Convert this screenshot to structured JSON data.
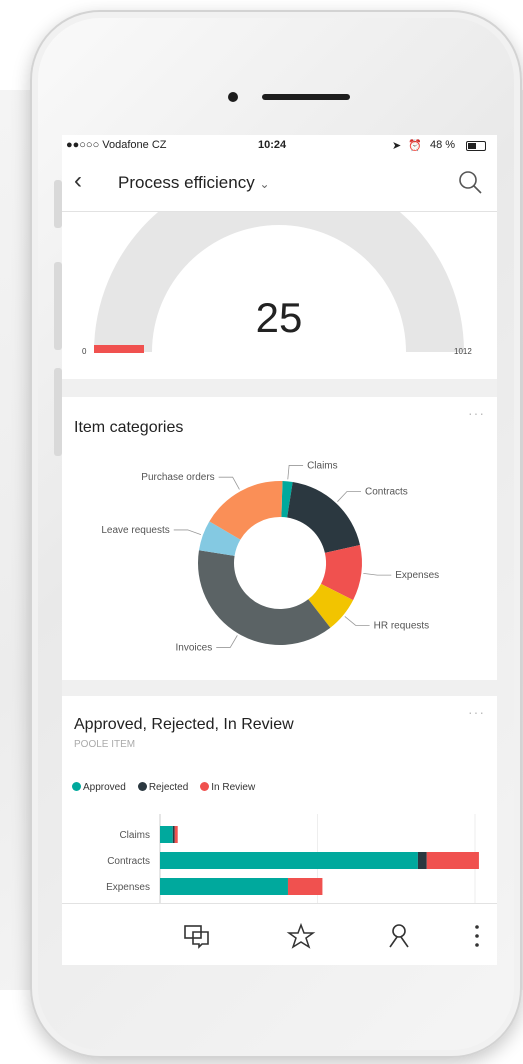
{
  "status_bar": {
    "carrier": "●●○○○ Vodafone CZ",
    "time": "10:24",
    "battery": "48 %"
  },
  "nav": {
    "title": "Process efficiency",
    "title_caret": "⌄"
  },
  "gauge": {
    "value": "25",
    "min": "0",
    "max": "1012"
  },
  "categories_card": {
    "title": "Item categories",
    "chart_data": {
      "type": "pie",
      "variant": "donut",
      "title": "Item categories",
      "series": [
        {
          "label": "Claims",
          "value": 2,
          "color": "#00a99d"
        },
        {
          "label": "Contracts",
          "value": 19,
          "color": "#2b3840"
        },
        {
          "label": "Expenses",
          "value": 11,
          "color": "#f0514f"
        },
        {
          "label": "HR requests",
          "value": 7,
          "color": "#f2c400"
        },
        {
          "label": "Invoices",
          "value": 38,
          "color": "#5b6365"
        },
        {
          "label": "Leave requests",
          "value": 6,
          "color": "#84c9e2"
        },
        {
          "label": "Purchase orders",
          "value": 17,
          "color": "#fa8f57"
        }
      ]
    }
  },
  "status_card": {
    "title": "Approved, Rejected, In Review",
    "subtitle": "POOLE ITEM",
    "legend": [
      {
        "label": "Approved",
        "color": "#00a99d"
      },
      {
        "label": "Rejected",
        "color": "#2b3840"
      },
      {
        "label": "In Review",
        "color": "#f0514f"
      }
    ],
    "chart_data": {
      "type": "bar",
      "orientation": "horizontal",
      "stacked": true,
      "categories": [
        "Claims",
        "Contracts",
        "Expenses"
      ],
      "series": [
        {
          "name": "Approved",
          "color": "#00a99d",
          "values": [
            13,
            262,
            130
          ]
        },
        {
          "name": "Rejected",
          "color": "#2b3840",
          "values": [
            2,
            9,
            0
          ]
        },
        {
          "name": "In Review",
          "color": "#f0514f",
          "values": [
            3,
            53,
            35
          ]
        }
      ],
      "xlim": [
        0,
        320
      ]
    }
  },
  "tab_bar": {
    "items": [
      "comments-icon",
      "star-icon",
      "person-icon",
      "more-icon"
    ]
  }
}
